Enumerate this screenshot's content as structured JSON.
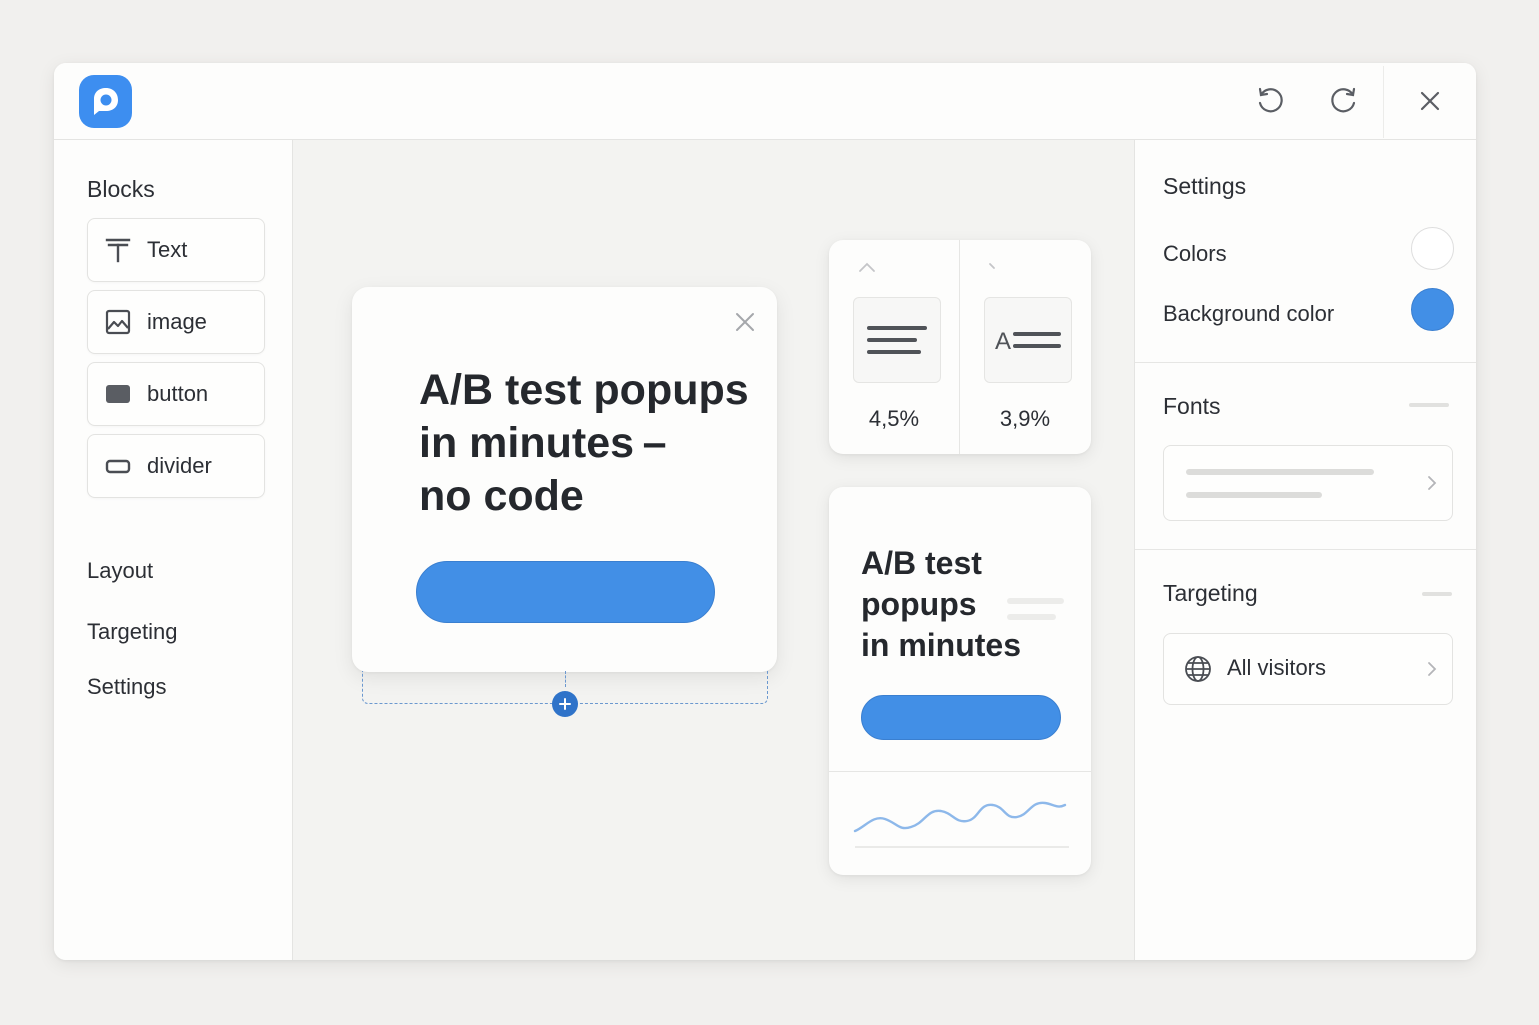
{
  "app": {
    "logo_icon": "speech-bubble-logo",
    "brand_color": "#3d8ef0",
    "toolbar": {
      "undo_icon": "undo-icon",
      "redo_icon": "redo-icon",
      "close_icon": "close-icon"
    }
  },
  "sidebar": {
    "blocks_title": "Blocks",
    "blocks": [
      {
        "label": "Text",
        "icon": "text-icon"
      },
      {
        "label": "image",
        "icon": "image-icon"
      },
      {
        "label": "button",
        "icon": "button-icon"
      },
      {
        "label": "divider",
        "icon": "divider-icon"
      }
    ],
    "nav": [
      {
        "label": "Layout"
      },
      {
        "label": "Targeting"
      },
      {
        "label": "Settings"
      }
    ]
  },
  "canvas": {
    "popup": {
      "headline_lines": [
        "A/B test popups",
        "in minutes –",
        "no code"
      ],
      "cta_color": "#428fe6"
    },
    "variants": [
      {
        "rate": "4,5%",
        "icon": "align-left-icon"
      },
      {
        "rate": "3,9%",
        "icon": "text-align-icon"
      }
    ],
    "preview": {
      "headline_lines": [
        "A/B test",
        "popups",
        "in minutes"
      ]
    }
  },
  "settings_panel": {
    "title": "Settings",
    "colors_label": "Colors",
    "colors_swatch": "#ffffff",
    "background_color_label": "Background color",
    "background_color_swatch": "#428fe6",
    "fonts_title": "Fonts",
    "targeting_title": "Targeting",
    "targeting_value": "All visitors"
  }
}
